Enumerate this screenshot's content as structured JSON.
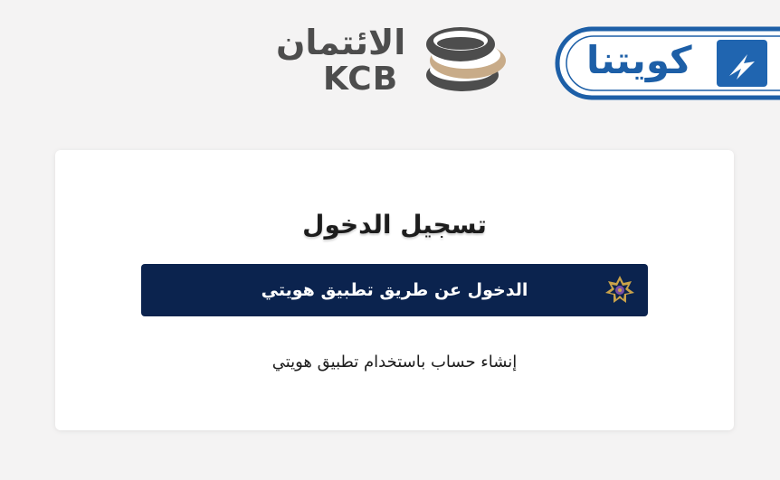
{
  "header": {
    "kcb_logo": {
      "arabic_name": "الائتمان",
      "latin_name": "KCB",
      "icon": "kcb-stacked-discs-icon"
    },
    "kuwaitna_badge": {
      "text": "كويتنا",
      "icon": "lightning-bolt-icon"
    }
  },
  "login_card": {
    "title": "تسجيل الدخول",
    "hawyti_login_button": {
      "label": "الدخول عن طريق تطبيق هويتي",
      "icon": "hawyti-emblem-icon"
    },
    "register_link": "إنشاء حساب باستخدام تطبيق هويتي"
  },
  "colors": {
    "page_background": "#f4f3f3",
    "button_background": "#0b234e",
    "brand_blue": "#2065b0",
    "kcb_gray": "#4d4d4d",
    "kcb_gold": "#c8ab88"
  }
}
